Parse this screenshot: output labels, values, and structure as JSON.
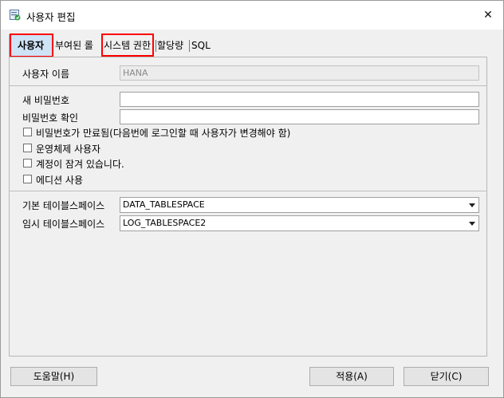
{
  "window": {
    "title": "사용자 편집",
    "close_icon": "✕"
  },
  "tabs": [
    {
      "label": "사용자"
    },
    {
      "label": "부여된 롤"
    },
    {
      "label": "시스템 권한"
    },
    {
      "label": "할당량"
    },
    {
      "label": "SQL"
    }
  ],
  "form": {
    "username_label": "사용자 이름",
    "username_value": "HANA",
    "new_password_label": "새 비밀번호",
    "new_password_value": "",
    "confirm_password_label": "비밀번호 확인",
    "confirm_password_value": "",
    "checkboxes": [
      {
        "label": "비밀번호가 만료됨(다음번에 로그인할 때 사용자가 변경해야 함)",
        "checked": false
      },
      {
        "label": "운영체제 사용자",
        "checked": false
      },
      {
        "label": "계정이 잠겨 있습니다.",
        "checked": false
      },
      {
        "label": "에디션 사용",
        "checked": false
      }
    ],
    "default_tablespace_label": "기본 테이블스페이스",
    "default_tablespace_value": "DATA_TABLESPACE",
    "temp_tablespace_label": "임시 테이블스페이스",
    "temp_tablespace_value": "LOG_TABLESPACE2"
  },
  "buttons": {
    "help": "도움말(H)",
    "apply": "적용(A)",
    "close": "닫기(C)"
  },
  "colors": {
    "highlight": "#ff0000",
    "active_tab": "#cfe3f7"
  }
}
